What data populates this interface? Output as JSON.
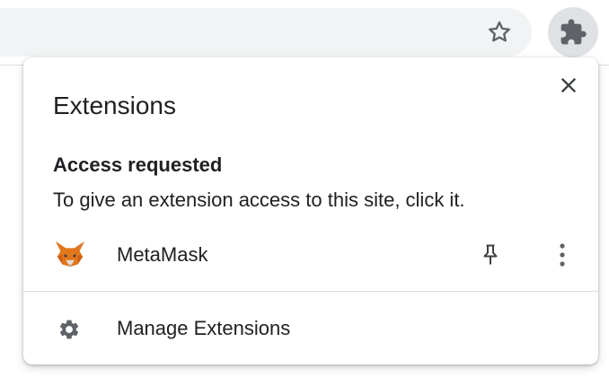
{
  "toolbar": {
    "bookmark_icon": "star-outline-icon",
    "extensions_icon": "puzzle-icon"
  },
  "popup": {
    "title": "Extensions",
    "close_icon": "close-icon",
    "section": {
      "heading": "Access requested",
      "description": "To give an extension access to this site, click it."
    },
    "extensions": [
      {
        "name": "MetaMask",
        "icon": "metamask-fox-icon",
        "pin_icon": "pin-icon",
        "menu_icon": "more-vertical-icon"
      }
    ],
    "manage": {
      "label": "Manage Extensions",
      "icon": "gear-icon"
    }
  },
  "colors": {
    "text": "#202124",
    "icon": "#5f6368",
    "omnibox_bg": "#f1f3f4",
    "active_button_bg": "#dfe1e5",
    "divider": "#dadce0",
    "fox_orange": "#e2761b"
  }
}
